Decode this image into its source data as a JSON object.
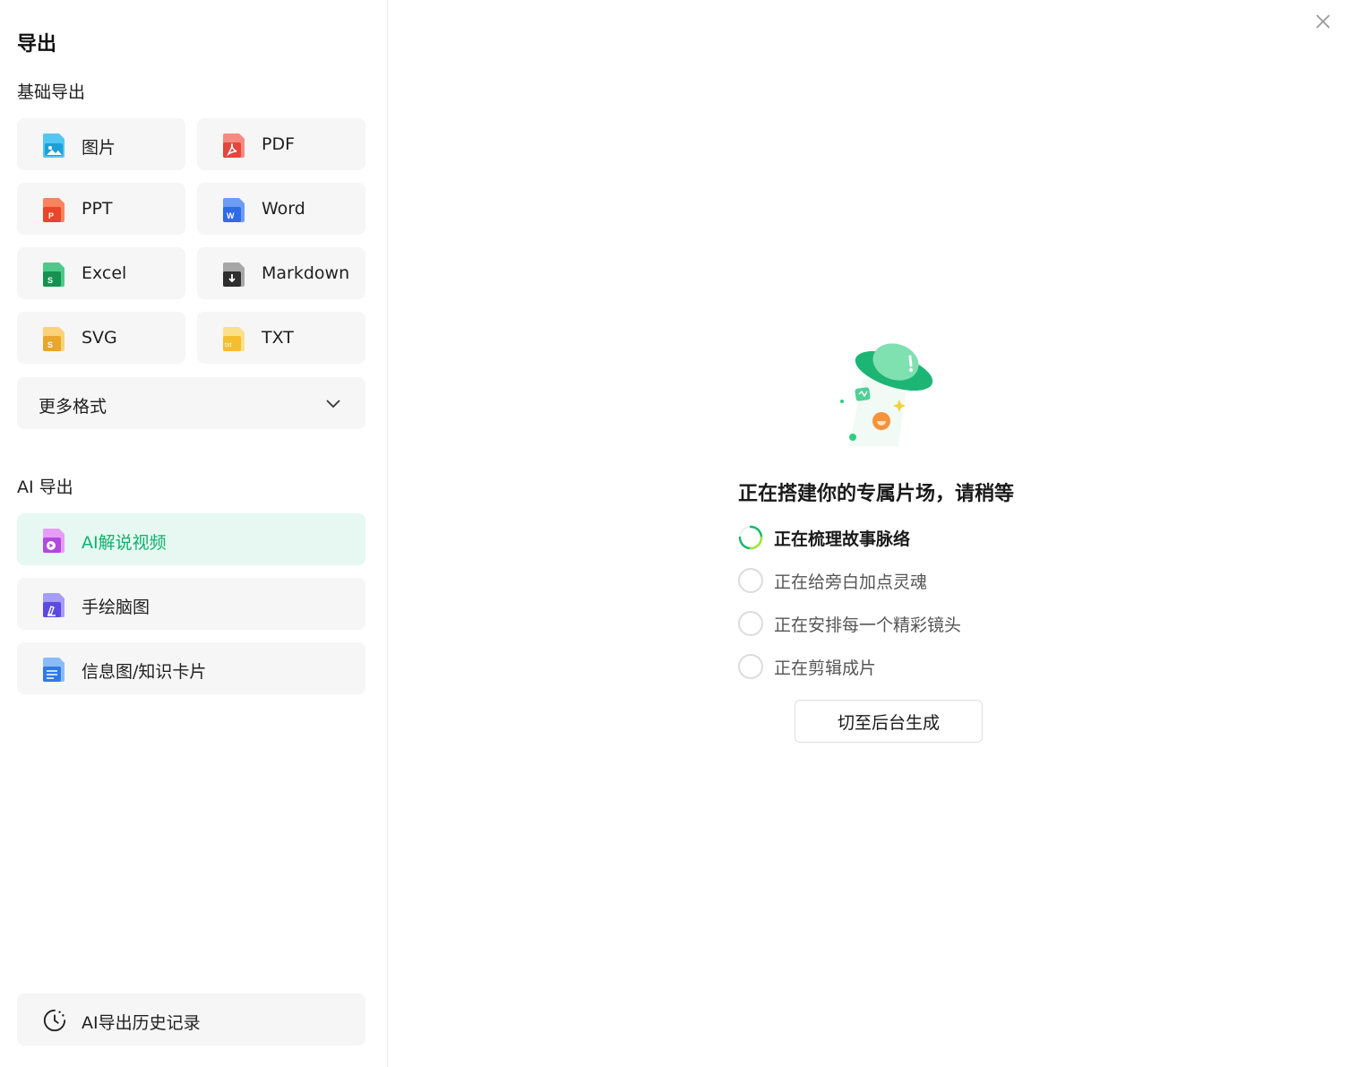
{
  "panel": {
    "title": "导出"
  },
  "basic_section": {
    "title": "基础导出",
    "formats": [
      {
        "label": "图片",
        "icon": "image-file-icon",
        "color": "#2ab3e8"
      },
      {
        "label": "PDF",
        "icon": "pdf-file-icon",
        "color": "#e5453c"
      },
      {
        "label": "PPT",
        "icon": "ppt-file-icon",
        "color": "#f0562c"
      },
      {
        "label": "Word",
        "icon": "word-file-icon",
        "color": "#2f6be6"
      },
      {
        "label": "Excel",
        "icon": "excel-file-icon",
        "color": "#1aa65c"
      },
      {
        "label": "Markdown",
        "icon": "markdown-file-icon",
        "color": "#3a3a3a"
      },
      {
        "label": "SVG",
        "icon": "svg-file-icon",
        "color": "#f4b43a"
      },
      {
        "label": "TXT",
        "icon": "txt-file-icon",
        "color": "#f7c23c"
      }
    ],
    "more_label": "更多格式"
  },
  "ai_section": {
    "title": "AI 导出",
    "items": [
      {
        "label": "AI解说视频",
        "icon": "video-file-icon",
        "color": "#b04adf",
        "active": true
      },
      {
        "label": "手绘脑图",
        "icon": "mindmap-file-icon",
        "color": "#6a5ae8",
        "active": false
      },
      {
        "label": "信息图/知识卡片",
        "icon": "infocard-file-icon",
        "color": "#3d8cf0",
        "active": false
      }
    ]
  },
  "history": {
    "label": "AI导出历史记录",
    "icon": "history-clock-icon"
  },
  "progress": {
    "title": "正在搭建你的专属片场，请稍等",
    "steps": [
      {
        "label": "正在梳理故事脉络",
        "status": "in-progress"
      },
      {
        "label": "正在给旁白加点灵魂",
        "status": "pending"
      },
      {
        "label": "正在安排每一个精彩镜头",
        "status": "pending"
      },
      {
        "label": "正在剪辑成片",
        "status": "pending"
      }
    ],
    "background_button": "切至后台生成"
  },
  "colors": {
    "accent": "#10b070",
    "active_bg": "#e6f8f1",
    "button_bg": "#f6f6f6"
  }
}
